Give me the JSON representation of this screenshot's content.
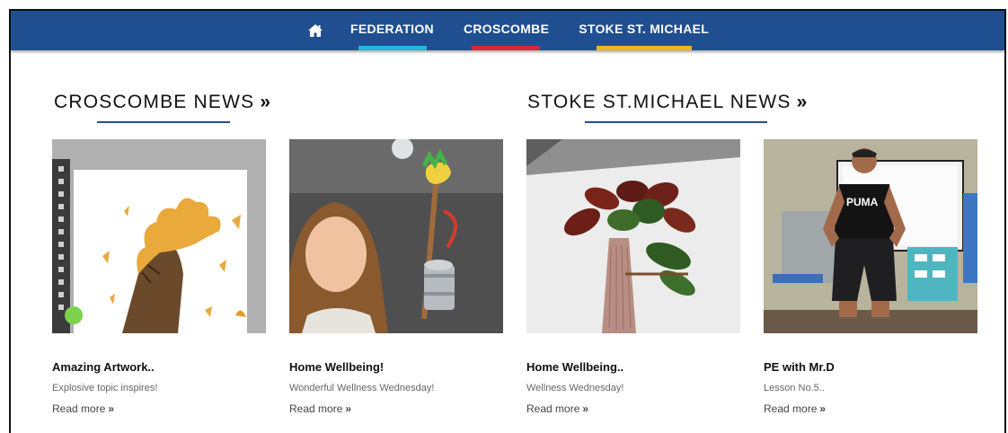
{
  "nav": {
    "home_icon": "home-icon",
    "items": [
      {
        "label": "FEDERATION",
        "color": "#1fb3e0"
      },
      {
        "label": "CROSCOMBE",
        "color": "#d4263d"
      },
      {
        "label": "STOKE ST. MICHAEL",
        "color": "#f2b321"
      }
    ]
  },
  "sections": [
    {
      "title": "CROSCOMBE NEWS",
      "arrow": "»"
    },
    {
      "title": "STOKE ST.MICHAEL NEWS",
      "arrow": "»"
    }
  ],
  "cards": [
    {
      "title": "Amazing Artwork..",
      "desc": "Explosive topic inspires!",
      "more": "Read more",
      "arrow": "»"
    },
    {
      "title": "Home Wellbeing!",
      "desc": "Wonderful Wellness Wednesday!",
      "more": "Read more",
      "arrow": "»"
    },
    {
      "title": "Home Wellbeing..",
      "desc": "Wellness Wednesday!",
      "more": "Read more",
      "arrow": "»"
    },
    {
      "title": "PE with Mr.D",
      "desc": "Lesson No.5..",
      "more": "Read more",
      "arrow": "»"
    }
  ],
  "colors": {
    "navbar": "#1f4f91",
    "underline": "#1f4f91"
  }
}
